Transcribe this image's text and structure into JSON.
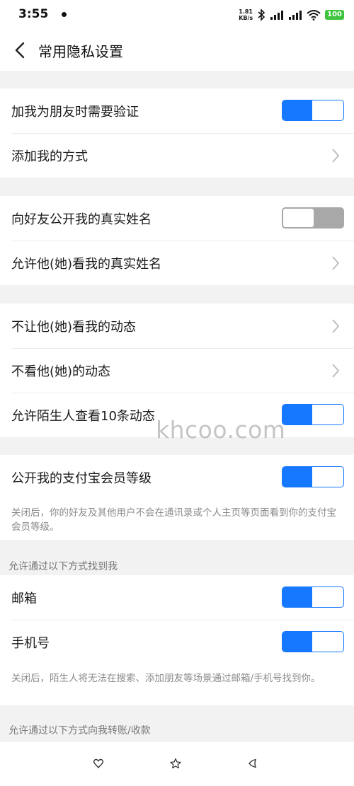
{
  "status_bar": {
    "time": "3:55",
    "net_speed_value": "1.81",
    "net_speed_unit": "KB/s",
    "battery": "100"
  },
  "header": {
    "title": "常用隐私设置"
  },
  "group1": {
    "verify_friend_label": "加我为朋友时需要验证",
    "verify_friend_on": true,
    "add_method_label": "添加我的方式"
  },
  "group2": {
    "show_real_name_label": "向好友公开我的真实姓名",
    "show_real_name_on": false,
    "allow_view_real_name_label": "允许他(她)看我的真实姓名"
  },
  "group3": {
    "block_view_moments_label": "不让他(她)看我的动态",
    "hide_their_moments_label": "不看他(她)的动态",
    "stranger_view_label": "允许陌生人查看10条动态",
    "stranger_view_on": true
  },
  "group4": {
    "member_level_label": "公开我的支付宝会员等级",
    "member_level_on": true,
    "member_level_note": "关闭后，你的好友及其他用户不会在通讯录或个人主页等页面看到你的支付宝会员等级。"
  },
  "find_me": {
    "section_title": "允许通过以下方式找到我",
    "email_label": "邮箱",
    "email_on": true,
    "phone_label": "手机号",
    "phone_on": true,
    "note": "关闭后，陌生人将无法在搜索、添加朋友等场景通过邮箱/手机号找到你。"
  },
  "transfer": {
    "section_title": "允许通过以下方式向我转账/收款"
  },
  "watermark": "khcoo.com",
  "colors": {
    "accent": "#1677ff",
    "toggle_off": "#a8a8a8",
    "background": "#f2f2f2"
  }
}
